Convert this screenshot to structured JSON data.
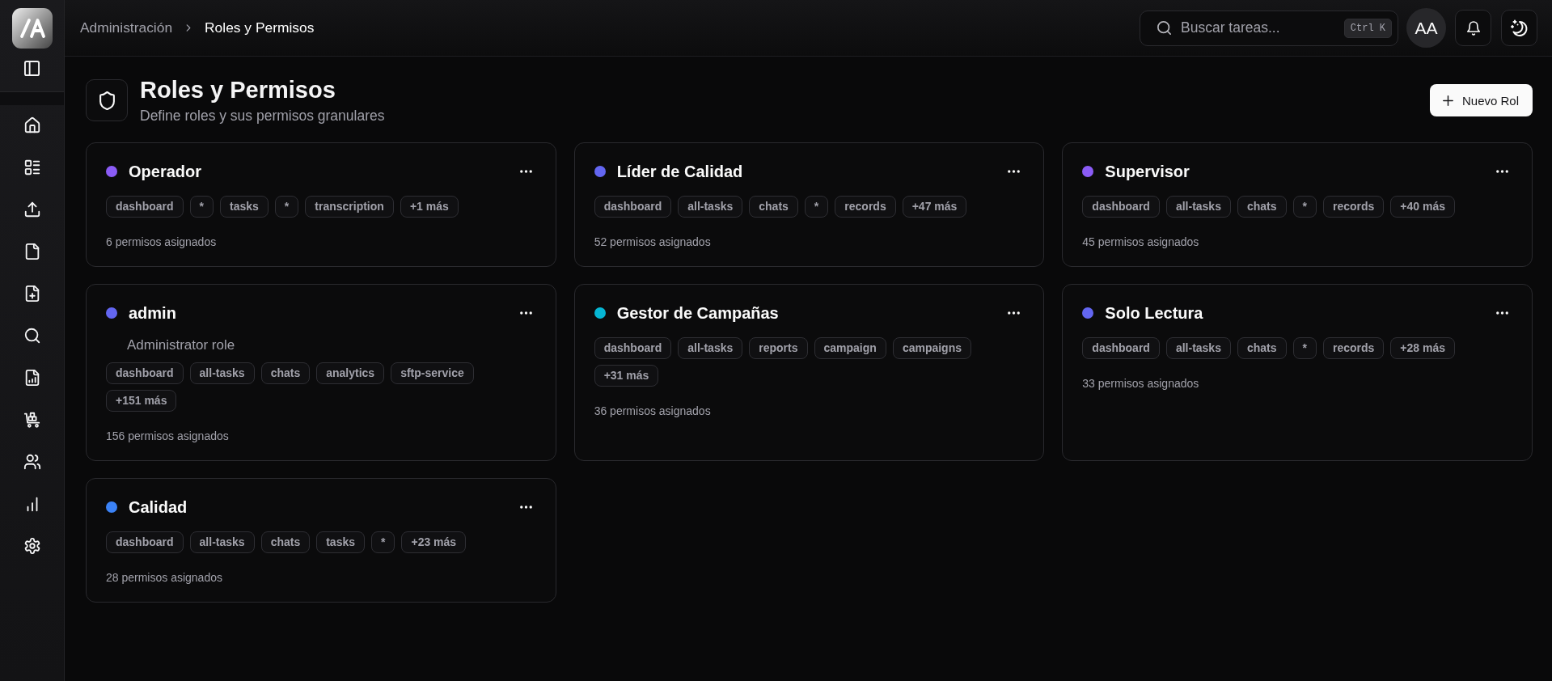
{
  "sidebar": {
    "items": [
      {
        "kind": "home"
      },
      {
        "kind": "list"
      },
      {
        "kind": "upload"
      },
      {
        "kind": "file"
      },
      {
        "kind": "file-plus"
      },
      {
        "kind": "search"
      },
      {
        "kind": "file-chart"
      },
      {
        "kind": "cart"
      },
      {
        "kind": "users"
      },
      {
        "kind": "bar-chart"
      },
      {
        "kind": "settings"
      }
    ]
  },
  "topbar": {
    "breadcrumb": [
      {
        "label": "Administración",
        "current": false
      },
      {
        "label": "Roles y Permisos",
        "current": true
      }
    ],
    "search": {
      "placeholder": "Buscar tareas...",
      "shortcut": "Ctrl K"
    },
    "avatar": "AA"
  },
  "page": {
    "title": "Roles y Permisos",
    "subtitle": "Define roles y sus permisos granulares",
    "new_button": "Nuevo Rol"
  },
  "roles": [
    {
      "name": "Operador",
      "color": "#8b5cf6",
      "tags": [
        "dashboard",
        "*",
        "tasks",
        "*",
        "transcription",
        "+1 más"
      ],
      "count": "6 permisos asignados"
    },
    {
      "name": "Líder de Calidad",
      "color": "#6366f1",
      "tags": [
        "dashboard",
        "all-tasks",
        "chats",
        "*",
        "records",
        "+47 más"
      ],
      "count": "52 permisos asignados"
    },
    {
      "name": "Supervisor",
      "color": "#8b5cf6",
      "tags": [
        "dashboard",
        "all-tasks",
        "chats",
        "*",
        "records",
        "+40 más"
      ],
      "count": "45 permisos asignados"
    },
    {
      "name": "admin",
      "color": "#6366f1",
      "description": "Administrator role",
      "tags": [
        "dashboard",
        "all-tasks",
        "chats",
        "analytics",
        "sftp-service",
        "+151 más"
      ],
      "count": "156 permisos asignados"
    },
    {
      "name": "Gestor de Campañas",
      "color": "#06b6d4",
      "tags": [
        "dashboard",
        "all-tasks",
        "reports",
        "campaign",
        "campaigns",
        "+31 más"
      ],
      "count": "36 permisos asignados"
    },
    {
      "name": "Solo Lectura",
      "color": "#6366f1",
      "tags": [
        "dashboard",
        "all-tasks",
        "chats",
        "*",
        "records",
        "+28 más"
      ],
      "count": "33 permisos asignados"
    },
    {
      "name": "Calidad",
      "color": "#3b82f6",
      "tags": [
        "dashboard",
        "all-tasks",
        "chats",
        "tasks",
        "*",
        "+23 más"
      ],
      "count": "28 permisos asignados"
    }
  ]
}
